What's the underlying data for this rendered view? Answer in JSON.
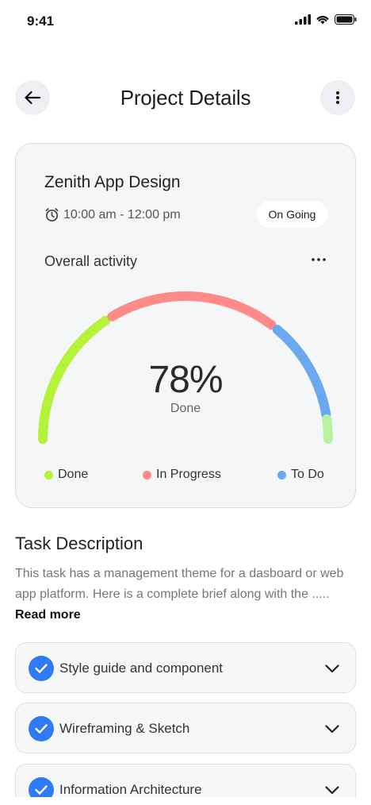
{
  "status_bar": {
    "time": "9:41"
  },
  "header": {
    "title": "Project Details"
  },
  "project": {
    "name": "Zenith App Design",
    "time_range": "10:00 am - 12:00 pm",
    "status": "On Going",
    "activity_label": "Overall activity",
    "percent_text": "78%",
    "percent_sub": "Done",
    "progress": 0.78,
    "segments": [
      {
        "label": "Done",
        "color": "#b5f23a"
      },
      {
        "label": "In Progress",
        "color": "#ff8a8a"
      },
      {
        "label": "To Do",
        "color": "#6aa8ef"
      }
    ],
    "tail_color": "#b9f0a2"
  },
  "task_section": {
    "title": "Task Description",
    "description": "This task has a management theme for a dasboard or web app platform. Here is a complete brief along with the .....",
    "read_more": "Read more"
  },
  "tasks": [
    {
      "label": "Style guide and component",
      "done": true
    },
    {
      "label": "Wireframing & Sketch",
      "done": true
    },
    {
      "label": "Information Architecture",
      "done": true
    }
  ],
  "icons": {
    "back": "arrow-left-icon",
    "more": "vertical-dots-icon",
    "clock": "alarm-clock-icon",
    "check": "check-icon",
    "chevron": "chevron-down-icon"
  }
}
